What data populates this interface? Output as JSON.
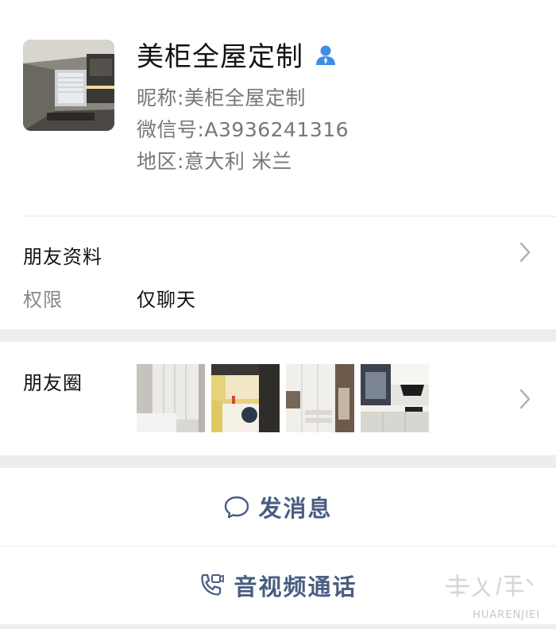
{
  "profile": {
    "display_name": "美柜全屋定制",
    "nickname": "昵称:美柜全屋定制",
    "wechat_id": "微信号:A3936241316",
    "region": "地区:意大利 米兰"
  },
  "friend_info": {
    "title": "朋友资料",
    "permission_label": "权限",
    "permission_value": "仅聊天"
  },
  "moments": {
    "title": "朋友圈",
    "thumbnails": [
      "white-wardrobe-photo",
      "yellow-kitchen-photo",
      "white-cabinet-photo",
      "grey-kitchen-photo"
    ]
  },
  "actions": {
    "message": "发消息",
    "call": "音视频通话"
  },
  "watermark": {
    "text": "HUARENJIEI"
  },
  "colors": {
    "action_text": "#4a5d82",
    "contact_icon": "#3d8ee8",
    "separator": "#ededed"
  }
}
